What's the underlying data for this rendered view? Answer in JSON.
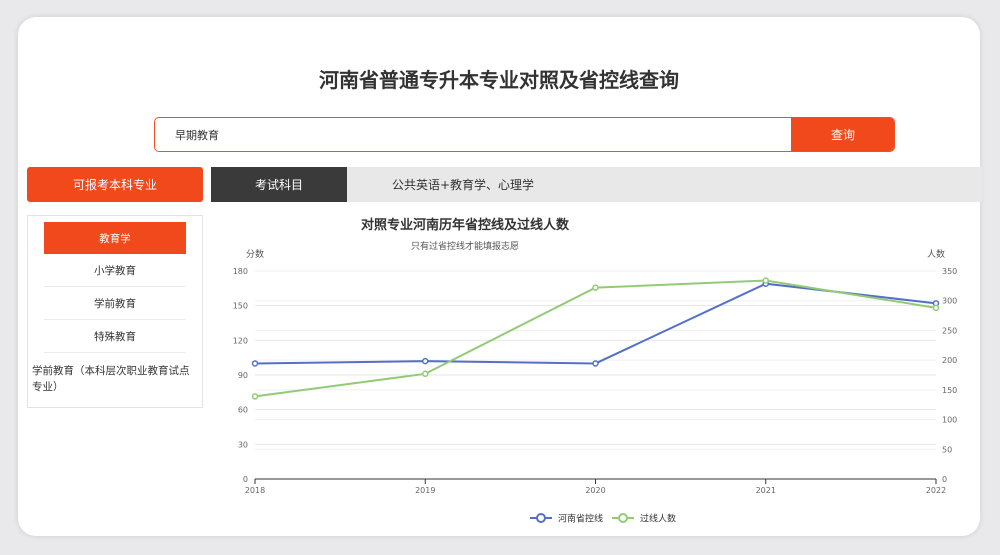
{
  "page": {
    "title": "河南省普通专升本专业对照及省控线查询"
  },
  "search": {
    "value": "早期教育",
    "button_label": "查询"
  },
  "sidebar": {
    "header": "可报考本科专业",
    "items": [
      {
        "label": "教育学"
      },
      {
        "label": "小学教育"
      },
      {
        "label": "学前教育"
      },
      {
        "label": "特殊教育"
      },
      {
        "label": "学前教育（本科层次职业教育试点专业）"
      }
    ]
  },
  "tabs": {
    "active_label": "考试科目",
    "subjects": "公共英语+教育学、心理学"
  },
  "colors": {
    "accent": "#f2491c",
    "series_blue": "#5470c6",
    "series_green": "#91cc75"
  },
  "chart_data": {
    "type": "line",
    "title": "对照专业河南历年省控线及过线人数",
    "subtitle": "只有过省控线才能填报志愿",
    "ylabel_left": "分数",
    "ylabel_right": "人数",
    "x": [
      "2018",
      "2019",
      "2020",
      "2021",
      "2022"
    ],
    "ylim_left": [
      0,
      180
    ],
    "yticks_left": [
      0,
      30,
      60,
      90,
      120,
      150,
      180
    ],
    "ylim_right": [
      0,
      350
    ],
    "yticks_right": [
      0,
      50,
      100,
      150,
      200,
      250,
      300,
      350
    ],
    "series": [
      {
        "name": "河南省控线",
        "axis": "left",
        "color": "#5470c6",
        "values": [
          100,
          102,
          100,
          169,
          152
        ]
      },
      {
        "name": "过线人数",
        "axis": "right",
        "color": "#91cc75",
        "values": [
          139,
          177,
          322,
          334,
          288
        ]
      }
    ],
    "legend": "bottom-center",
    "grid": true
  }
}
